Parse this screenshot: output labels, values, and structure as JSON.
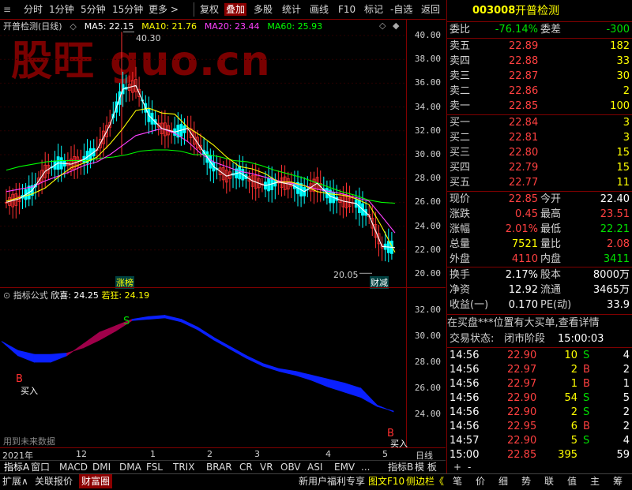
{
  "toolbar": {
    "periods": [
      "分时",
      "1分钟",
      "5分钟",
      "15分钟",
      "更多 >"
    ],
    "actions": [
      "复权",
      "叠加",
      "多股",
      "统计",
      "画线",
      "F10",
      "标记",
      "-自选",
      "返回"
    ],
    "active_action": "叠加"
  },
  "main_chart": {
    "title": "开普检测(日线)",
    "ma": [
      {
        "label": "MA5: 22.15",
        "color": "#ffffff"
      },
      {
        "label": "MA10: 21.76",
        "color": "#ffff00"
      },
      {
        "label": "MA20: 23.44",
        "color": "#ff40ff"
      },
      {
        "label": "MA60: 25.93",
        "color": "#00ff00"
      }
    ],
    "watermark": "股旺 guo.cn",
    "high_label": "40.30",
    "low_label": "20.05",
    "badge_left": "涨榜",
    "badge_right": "财减",
    "y_ticks": [
      "40.00",
      "38.00",
      "36.00",
      "34.00",
      "32.00",
      "30.00",
      "28.00",
      "26.00",
      "24.00",
      "22.00",
      "20.00"
    ]
  },
  "chart_data": [
    {
      "type": "candlestick",
      "title": "开普检测(日线)",
      "y_range": [
        19.5,
        40.5
      ],
      "series_names": [
        "MA5",
        "MA10",
        "MA20",
        "MA60"
      ],
      "ma_last": {
        "MA5": 22.15,
        "MA10": 21.76,
        "MA20": 23.44,
        "MA60": 25.93
      },
      "ma5": [
        26.0,
        26.3,
        27.0,
        28.6,
        29.3,
        29.2,
        29.6,
        30.4,
        32.5,
        35.5,
        35.8,
        33.3,
        32.2,
        31.9,
        32.2,
        30.6,
        29.0,
        28.2,
        28.5,
        27.8,
        27.4,
        27.7,
        27.5,
        26.9,
        27.6,
        26.5,
        26.1,
        25.9,
        24.9,
        22.3,
        22.2
      ],
      "ma10": [
        26.1,
        26.4,
        26.7,
        27.2,
        28.1,
        28.9,
        29.3,
        29.8,
        30.9,
        32.2,
        33.7,
        33.9,
        33.5,
        33.4,
        32.3,
        31.6,
        30.8,
        29.8,
        29.0,
        28.8,
        28.4,
        27.7,
        27.7,
        27.4,
        26.9,
        26.7,
        26.6,
        26.3,
        25.8,
        23.9,
        21.8
      ],
      "ma20": [
        26.9,
        27.1,
        27.3,
        27.8,
        28.2,
        28.6,
        29.1,
        29.4,
        30.0,
        30.8,
        31.6,
        31.9,
        32.2,
        31.8,
        31.1,
        30.1,
        29.4,
        29.0,
        28.6,
        28.4,
        28.1,
        27.8,
        27.6,
        27.4,
        27.1,
        26.9,
        26.7,
        26.4,
        26.1,
        24.8,
        23.44
      ],
      "ma60": [
        28.7,
        29.0,
        29.2,
        29.4,
        29.5,
        29.5,
        29.5,
        29.7,
        29.8,
        30.0,
        30.3,
        30.4,
        30.4,
        30.3,
        30.0,
        30.0,
        29.8,
        29.5,
        29.4,
        29.1,
        28.7,
        28.4,
        28.1,
        27.7,
        27.3,
        26.9,
        26.6,
        26.2,
        26.0,
        25.93
      ]
    },
    {
      "type": "area",
      "title": "指标公式",
      "y_range": [
        22.8,
        33.2
      ],
      "series": [
        {
          "name": "欣喜",
          "last": 24.25,
          "values": [
            29.6,
            28.9,
            28.6,
            28.6,
            28.7,
            29.1,
            29.7,
            30.4,
            31.2,
            31.3,
            31.4,
            31.1,
            30.5,
            29.7,
            29.0,
            28.3,
            27.7,
            27.3,
            27.0,
            26.6,
            26.1,
            25.7,
            25.3,
            24.6,
            24.25
          ]
        },
        {
          "name": "若狂",
          "last": 24.19,
          "values": [
            29.6,
            28.5,
            28.0,
            28.0,
            28.5,
            29.4,
            30.3,
            30.8,
            31.3,
            31.5,
            31.6,
            31.3,
            30.7,
            29.9,
            29.2,
            28.5,
            27.9,
            27.5,
            27.3,
            27.0,
            26.7,
            26.4,
            26.0,
            24.7,
            24.19
          ]
        }
      ],
      "signals": [
        {
          "label": "B",
          "index": 0
        },
        {
          "label": "S",
          "index": 6
        },
        {
          "label": "B",
          "index": 24
        }
      ]
    }
  ],
  "ind_chart": {
    "name": "指标公式",
    "line1_label": "欣喜: 24.25",
    "line2_label": "若狂: 24.19",
    "line1_color": "#ffffff",
    "line2_color": "#ffff00",
    "sig_b1": "B",
    "sig_buy1": "买入",
    "sig_s": "S",
    "sig_b2": "B",
    "sig_buy2": "买入",
    "note": "用到未来数据",
    "y_ticks": [
      "32.00",
      "30.00",
      "28.00",
      "26.00",
      "24.00"
    ]
  },
  "timeline": {
    "labels": [
      "2021年",
      "12",
      "1",
      "2",
      "3",
      "4",
      "5"
    ],
    "period": "日线"
  },
  "indicator_tabs": [
    "指标A",
    "窗口",
    "MACD",
    "DMI",
    "DMA",
    "FSL",
    "TRIX",
    "BRAR",
    "CR",
    "VR",
    "OBV",
    "ASI",
    "EMV",
    "...",
    "指标B",
    "模 板",
    "+",
    "-"
  ],
  "footer": {
    "left": [
      "扩展∧",
      "关联报价",
      "财富圈"
    ],
    "promo": "新用户福利专享",
    "right": [
      "图文F10",
      "侧边栏《"
    ],
    "panel_tabs": [
      "笔",
      "价",
      "细",
      "势",
      "联",
      "值",
      "主",
      "筹"
    ]
  },
  "stock": {
    "code": "003008",
    "name": "开普检测"
  },
  "commission": {
    "ratio_label": "委比",
    "ratio": "-76.14%",
    "diff_label": "委差",
    "diff": "-300"
  },
  "asks": [
    {
      "label": "卖五",
      "price": "22.89",
      "vol": "182"
    },
    {
      "label": "卖四",
      "price": "22.88",
      "vol": "33"
    },
    {
      "label": "卖三",
      "price": "22.87",
      "vol": "30"
    },
    {
      "label": "卖二",
      "price": "22.86",
      "vol": "2"
    },
    {
      "label": "卖一",
      "price": "22.85",
      "vol": "100"
    }
  ],
  "bids": [
    {
      "label": "买一",
      "price": "22.84",
      "vol": "3"
    },
    {
      "label": "买二",
      "price": "22.81",
      "vol": "3"
    },
    {
      "label": "买三",
      "price": "22.80",
      "vol": "15"
    },
    {
      "label": "买四",
      "price": "22.79",
      "vol": "15"
    },
    {
      "label": "买五",
      "price": "22.77",
      "vol": "11"
    }
  ],
  "quote": [
    {
      "l1": "现价",
      "v1": "22.85",
      "c1": "red",
      "l2": "今开",
      "v2": "22.40",
      "c2": "wht"
    },
    {
      "l1": "涨跌",
      "v1": "0.45",
      "c1": "red",
      "l2": "最高",
      "v2": "23.51",
      "c2": "red"
    },
    {
      "l1": "涨幅",
      "v1": "2.01%",
      "c1": "red",
      "l2": "最低",
      "v2": "22.21",
      "c2": "grn"
    },
    {
      "l1": "总量",
      "v1": "7521",
      "c1": "yel",
      "l2": "量比",
      "v2": "2.08",
      "c2": "red"
    },
    {
      "l1": "外盘",
      "v1": "4110",
      "c1": "red",
      "l2": "内盘",
      "v2": "3411",
      "c2": "grn"
    }
  ],
  "fundamentals": [
    {
      "l1": "换手",
      "v1": "2.17%",
      "l2": "股本",
      "v2": "8000万"
    },
    {
      "l1": "净资",
      "v1": "12.92",
      "l2": "流通",
      "v2": "3465万"
    },
    {
      "l1": "收益(一)",
      "v1": "0.170",
      "l2": "PE(动)",
      "v2": "33.9"
    }
  ],
  "alert": "在买盘***位置有大买单,查看详情",
  "status_label": "交易状态:",
  "status_value": "闭市阶段",
  "status_time": "15:00:03",
  "ticks": [
    {
      "t": "14:56",
      "p": "22.90",
      "v": "10",
      "s": "S",
      "n": "4"
    },
    {
      "t": "14:56",
      "p": "22.97",
      "v": "2",
      "s": "B",
      "n": "2"
    },
    {
      "t": "14:56",
      "p": "22.97",
      "v": "1",
      "s": "B",
      "n": "1"
    },
    {
      "t": "14:56",
      "p": "22.90",
      "v": "54",
      "s": "S",
      "n": "5"
    },
    {
      "t": "14:56",
      "p": "22.90",
      "v": "2",
      "s": "S",
      "n": "2"
    },
    {
      "t": "14:56",
      "p": "22.95",
      "v": "6",
      "s": "B",
      "n": "2"
    },
    {
      "t": "14:57",
      "p": "22.90",
      "v": "5",
      "s": "S",
      "n": "4"
    },
    {
      "t": "15:00",
      "p": "22.85",
      "v": "395",
      "s": "",
      "n": "59"
    }
  ]
}
